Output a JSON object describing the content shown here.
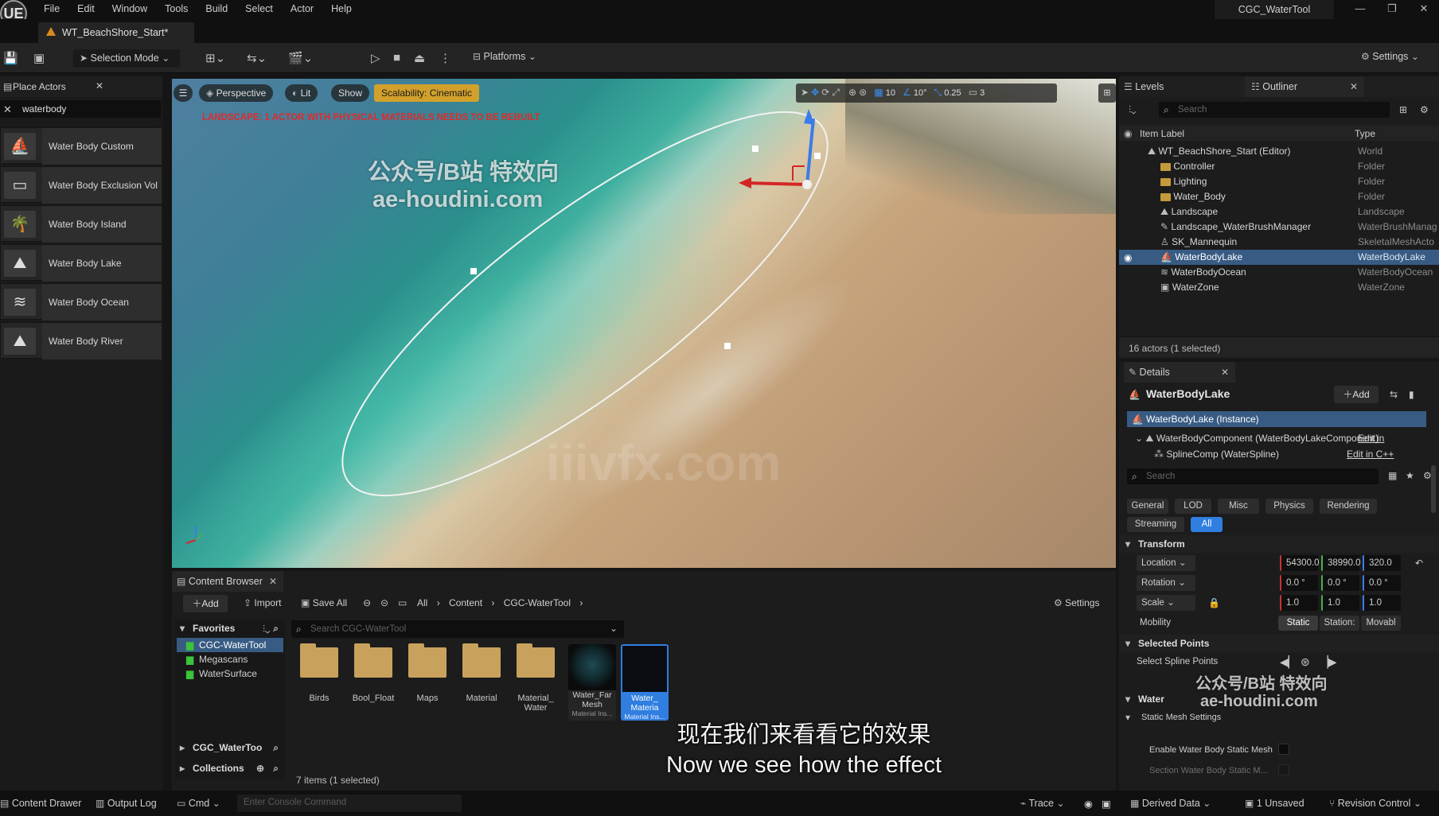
{
  "app": {
    "title": "CGC_WaterTool",
    "logo": "UE",
    "menu": [
      "File",
      "Edit",
      "Window",
      "Tools",
      "Build",
      "Select",
      "Actor",
      "Help"
    ],
    "level_tab": "WT_BeachShore_Start*"
  },
  "toolbar": {
    "selection_mode": "Selection Mode",
    "platforms": "Platforms",
    "settings": "Settings"
  },
  "place_actors": {
    "tab": "Place Actors",
    "search_value": "waterbody",
    "items": [
      {
        "label": "Water Body Custom",
        "icon": "water-body-custom-icon"
      },
      {
        "label": "Water Body Exclusion Vol",
        "icon": "water-body-exclusion-icon"
      },
      {
        "label": "Water Body Island",
        "icon": "water-body-island-icon"
      },
      {
        "label": "Water Body Lake",
        "icon": "water-body-lake-icon"
      },
      {
        "label": "Water Body Ocean",
        "icon": "water-body-ocean-icon"
      },
      {
        "label": "Water Body River",
        "icon": "water-body-river-icon"
      }
    ]
  },
  "viewport": {
    "perspective": "Perspective",
    "lit": "Lit",
    "show": "Show",
    "scalability": "Scalability: Cinematic",
    "warning": "LANDSCAPE: 1 ACTOR WITH PHYSICAL MATERIALS NEEDS TO BE REBUILT",
    "watermark_cn": "公众号/B站 特效向",
    "watermark_url": "ae-houdini.com",
    "watermark_faint": "iiivfx.com",
    "grid_snap": "10",
    "rot_snap": "10°",
    "scale_snap": "0.25",
    "camera_speed": "3"
  },
  "outliner": {
    "tab_levels": "Levels",
    "tab_outliner": "Outliner",
    "search_placeholder": "Search",
    "col_label": "Item Label",
    "col_type": "Type",
    "rows": [
      {
        "name": "WT_BeachShore_Start (Editor)",
        "type": "World"
      },
      {
        "name": "Controller",
        "type": "Folder"
      },
      {
        "name": "Lighting",
        "type": "Folder"
      },
      {
        "name": "Water_Body",
        "type": "Folder"
      },
      {
        "name": "Landscape",
        "type": "Landscape"
      },
      {
        "name": "Landscape_WaterBrushManager",
        "type": "WaterBrushManag"
      },
      {
        "name": "SK_Mannequin",
        "type": "SkeletalMeshActo"
      },
      {
        "name": "WaterBodyLake",
        "type": "WaterBodyLake"
      },
      {
        "name": "WaterBodyOcean",
        "type": "WaterBodyOcean"
      },
      {
        "name": "WaterZone",
        "type": "WaterZone"
      }
    ],
    "status": "16 actors (1 selected)"
  },
  "details": {
    "tab": "Details",
    "actor_name": "WaterBodyLake",
    "add": "Add",
    "instance": "WaterBodyLake (Instance)",
    "component": "WaterBodyComponent (WaterBodyLakeComponent)",
    "component_edit": "Edit in",
    "spline": "SplineComp (WaterSpline)",
    "spline_edit": "Edit in C++",
    "search_placeholder": "Search",
    "filters": [
      "General",
      "LOD",
      "Misc",
      "Physics",
      "Rendering",
      "Streaming",
      "All"
    ],
    "transform": {
      "title": "Transform",
      "location_label": "Location",
      "location": [
        "54300.0",
        "38990.0",
        "320.0"
      ],
      "rotation_label": "Rotation",
      "rotation": [
        "0.0 °",
        "0.0 °",
        "0.0 °"
      ],
      "scale_label": "Scale",
      "scale": [
        "1.0",
        "1.0",
        "1.0"
      ],
      "mobility_label": "Mobility",
      "mobility": [
        "Static",
        "Station:",
        "Movabl"
      ]
    },
    "selected_points": "Selected Points",
    "select_spline_points": "Select Spline Points",
    "water": "Water",
    "static_mesh_settings": "Static Mesh Settings",
    "enable_static_mesh": "Enable Water Body Static Mesh",
    "section_static_mesh": "Section Water Body Static M..."
  },
  "content_browser": {
    "tab": "Content Browser",
    "add": "Add",
    "import": "Import",
    "save_all": "Save All",
    "breadcrumb": [
      "All",
      "Content",
      "CGC-WaterTool"
    ],
    "settings": "Settings",
    "favorites": "Favorites",
    "tree": [
      "CGC-WaterTool",
      "Megascans",
      "WaterSurface"
    ],
    "section_project": "CGC_WaterToo",
    "collections": "Collections",
    "search_placeholder": "Search CGC-WaterTool",
    "assets": [
      {
        "label": "Birds",
        "kind": "folder"
      },
      {
        "label": "Bool_Float",
        "kind": "folder"
      },
      {
        "label": "Maps",
        "kind": "folder"
      },
      {
        "label": "Material",
        "kind": "folder"
      },
      {
        "label": "Material_ Water",
        "kind": "folder"
      },
      {
        "label": "Water_Far Mesh",
        "sub": "Material Ins...",
        "kind": "material"
      },
      {
        "label": "Water_ Materia",
        "sub": "Material Ins...",
        "kind": "material"
      }
    ],
    "item_count": "7 items (1 selected)"
  },
  "subtitles": {
    "cn": "现在我们来看看它的效果",
    "en": "Now we see how the effect"
  },
  "statusbar": {
    "content_drawer": "Content Drawer",
    "output_log": "Output Log",
    "cmd": "Cmd",
    "console_placeholder": "Enter Console Command",
    "trace": "Trace",
    "derived_data": "Derived Data",
    "unsaved": "1 Unsaved",
    "revision_control": "Revision Control"
  }
}
